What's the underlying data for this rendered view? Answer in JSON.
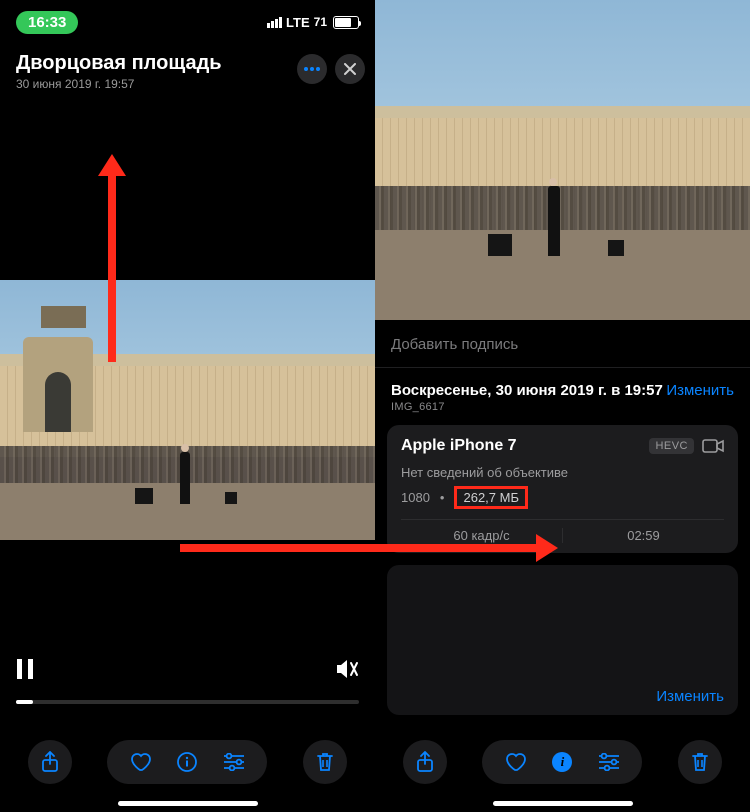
{
  "status": {
    "time": "16:33",
    "network": "LTE",
    "battery": "71"
  },
  "left": {
    "title": "Дворцовая площадь",
    "subtitle": "30 июня 2019 г.  19:57"
  },
  "right": {
    "caption_placeholder": "Добавить подпись",
    "date_full": "Воскресенье, 30 июня 2019 г. в 19:57",
    "edit": "Изменить",
    "filename": "IMG_6617",
    "device": "Apple iPhone 7",
    "codec": "HEVC",
    "lens_info": "Нет сведений об объективе",
    "res_prefix": "1080",
    "size": "262,7 МБ",
    "fps": "60 кадр/с",
    "duration": "02:59",
    "map_edit": "Изменить"
  }
}
